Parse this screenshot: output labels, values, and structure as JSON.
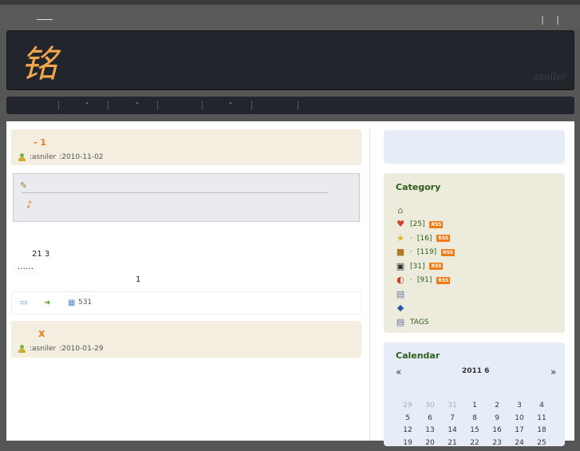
{
  "site": {
    "logo": "铭",
    "signature": "asniler"
  },
  "posts": [
    {
      "title": "-     1",
      "author_label": ":asniler",
      "date": ":2010-11-02",
      "lines": [
        "21       3",
        "……",
        "1"
      ],
      "views": "531"
    },
    {
      "title": "X",
      "author_label": ":asniler",
      "date": ":2010-01-29"
    }
  ],
  "sidebar": {
    "category": {
      "title": "Category",
      "items": [
        {
          "icon": "home-icon",
          "label": ""
        },
        {
          "icon": "heart-icon",
          "count": "[25]",
          "rss": "RSS"
        },
        {
          "icon": "star-icon",
          "count": "[16]",
          "rss": "RSS",
          "prefix": "·"
        },
        {
          "icon": "box-icon",
          "count": "[119]",
          "rss": "RSS",
          "prefix": "·"
        },
        {
          "icon": "person-icon",
          "count": "[31]",
          "rss": "RSS"
        },
        {
          "icon": "compass-icon",
          "count": "[91]",
          "rss": "RSS",
          "prefix": "·"
        },
        {
          "icon": "page-icon",
          "label": ""
        },
        {
          "icon": "book-icon",
          "label": ""
        },
        {
          "icon": "tags-icon",
          "label": "TAGS"
        }
      ]
    },
    "calendar": {
      "title": "Calendar",
      "prev": "«",
      "next": "»",
      "month": "2011 6",
      "weeks": [
        [
          "29",
          "30",
          "31",
          "1",
          "2",
          "3",
          "4"
        ],
        [
          "5",
          "6",
          "7",
          "8",
          "9",
          "10",
          "11"
        ],
        [
          "12",
          "13",
          "14",
          "15",
          "16",
          "17",
          "18"
        ],
        [
          "19",
          "20",
          "21",
          "22",
          "23",
          "24",
          "25"
        ]
      ]
    }
  }
}
